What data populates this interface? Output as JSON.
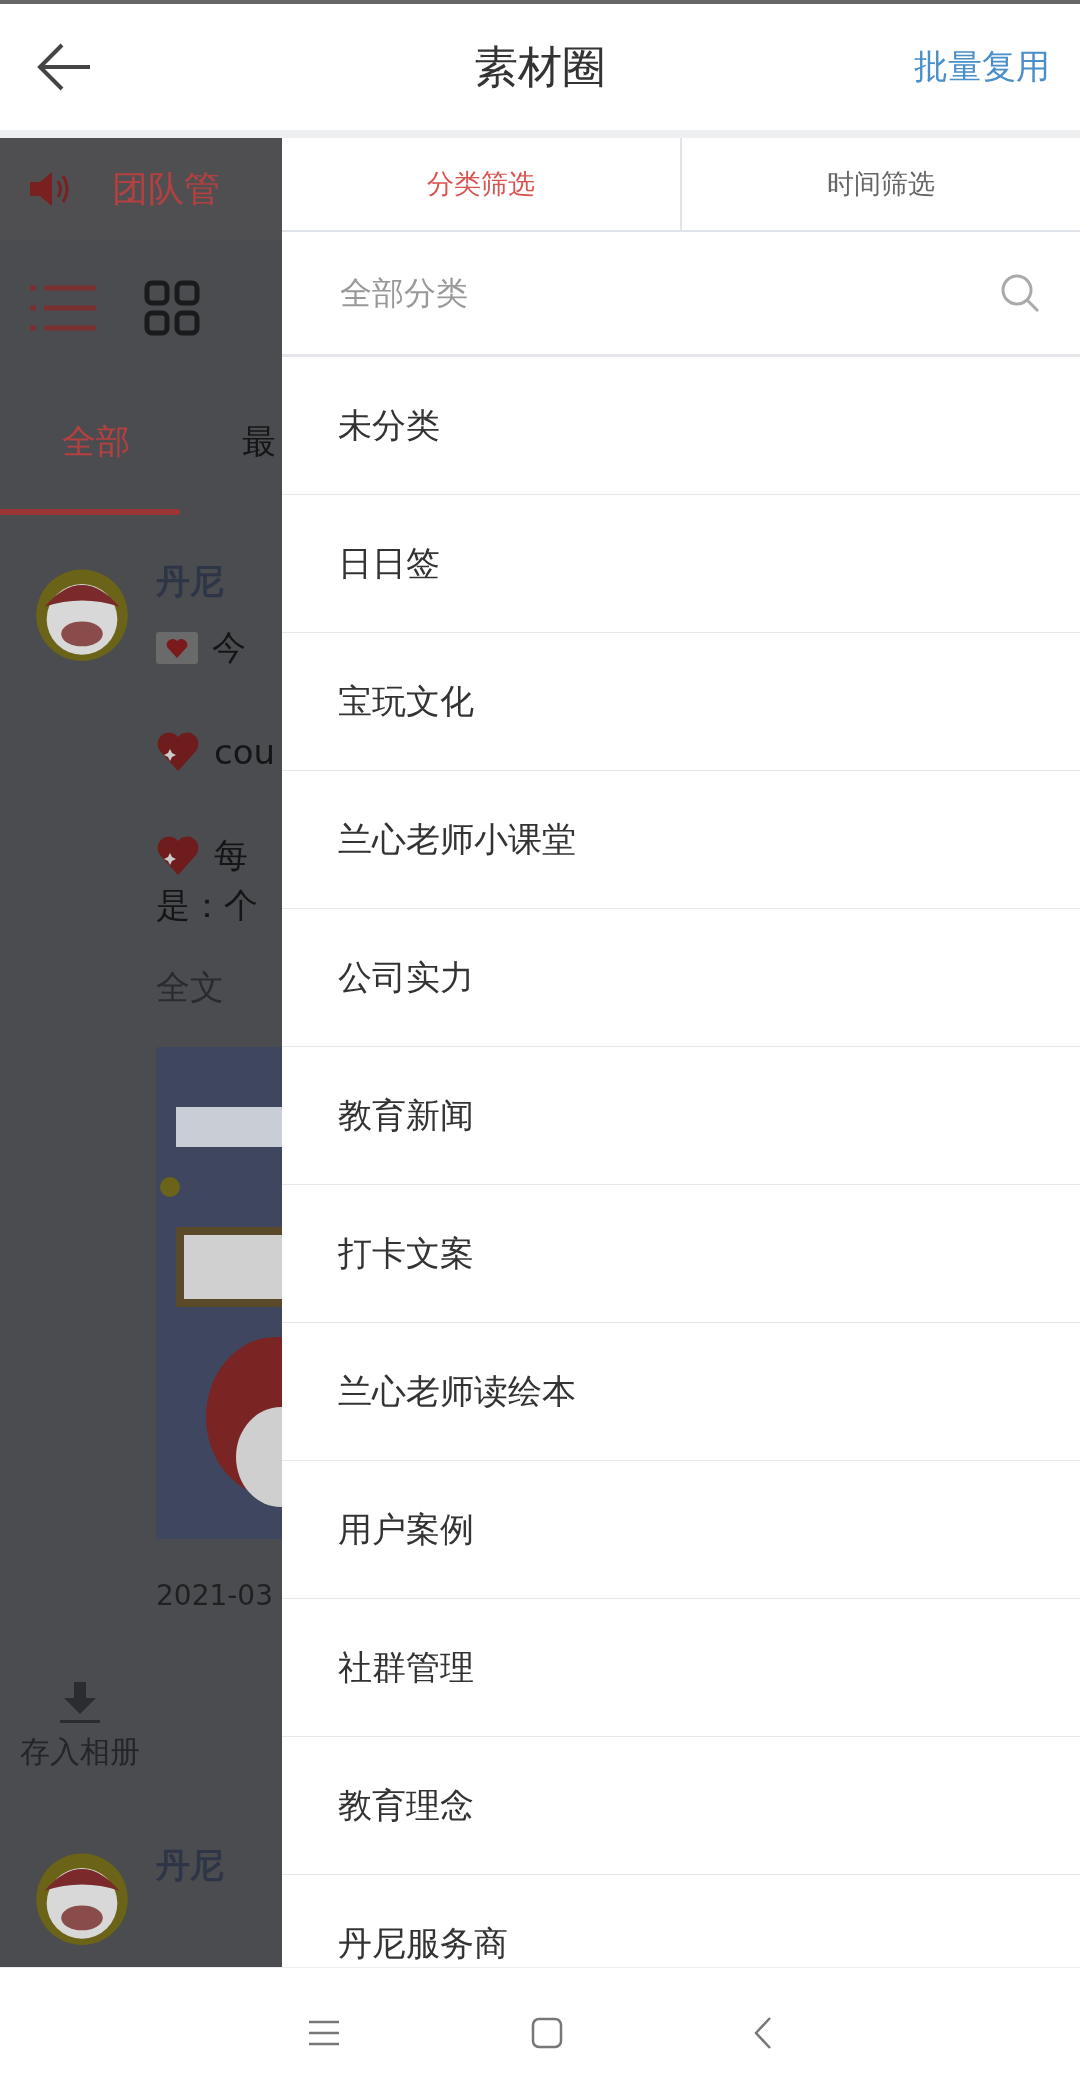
{
  "header": {
    "title": "素材圈",
    "action": "批量复用"
  },
  "background": {
    "notice": "团队管",
    "views": [
      {
        "kind": "list",
        "selected": true
      },
      {
        "kind": "grid",
        "selected": false
      }
    ],
    "tabs": [
      {
        "label": "全部",
        "selected": true
      },
      {
        "label": "最",
        "selected": false
      }
    ],
    "post": {
      "author": "丹尼",
      "lines": [
        {
          "kind": "envelope",
          "text": "今"
        },
        {
          "kind": "heart",
          "text": "cou"
        },
        {
          "kind": "heart",
          "text": "每"
        },
        {
          "kind": "text",
          "text": "是：个"
        }
      ],
      "more": "全文",
      "date": "2021-03",
      "save": "存入相册"
    },
    "next_post": {
      "author": "丹尼"
    }
  },
  "drawer": {
    "tabs": [
      {
        "label": "分类筛选",
        "selected": true
      },
      {
        "label": "时间筛选",
        "selected": false
      }
    ],
    "search": {
      "placeholder": "全部分类"
    },
    "categories": [
      "未分类",
      "日日签",
      "宝玩文化",
      "兰心老师小课堂",
      "公司实力",
      "教育新闻",
      "打卡文案",
      "兰心老师读绘本",
      "用户案例",
      "社群管理",
      "教育理念",
      "丹尼服务商"
    ]
  }
}
